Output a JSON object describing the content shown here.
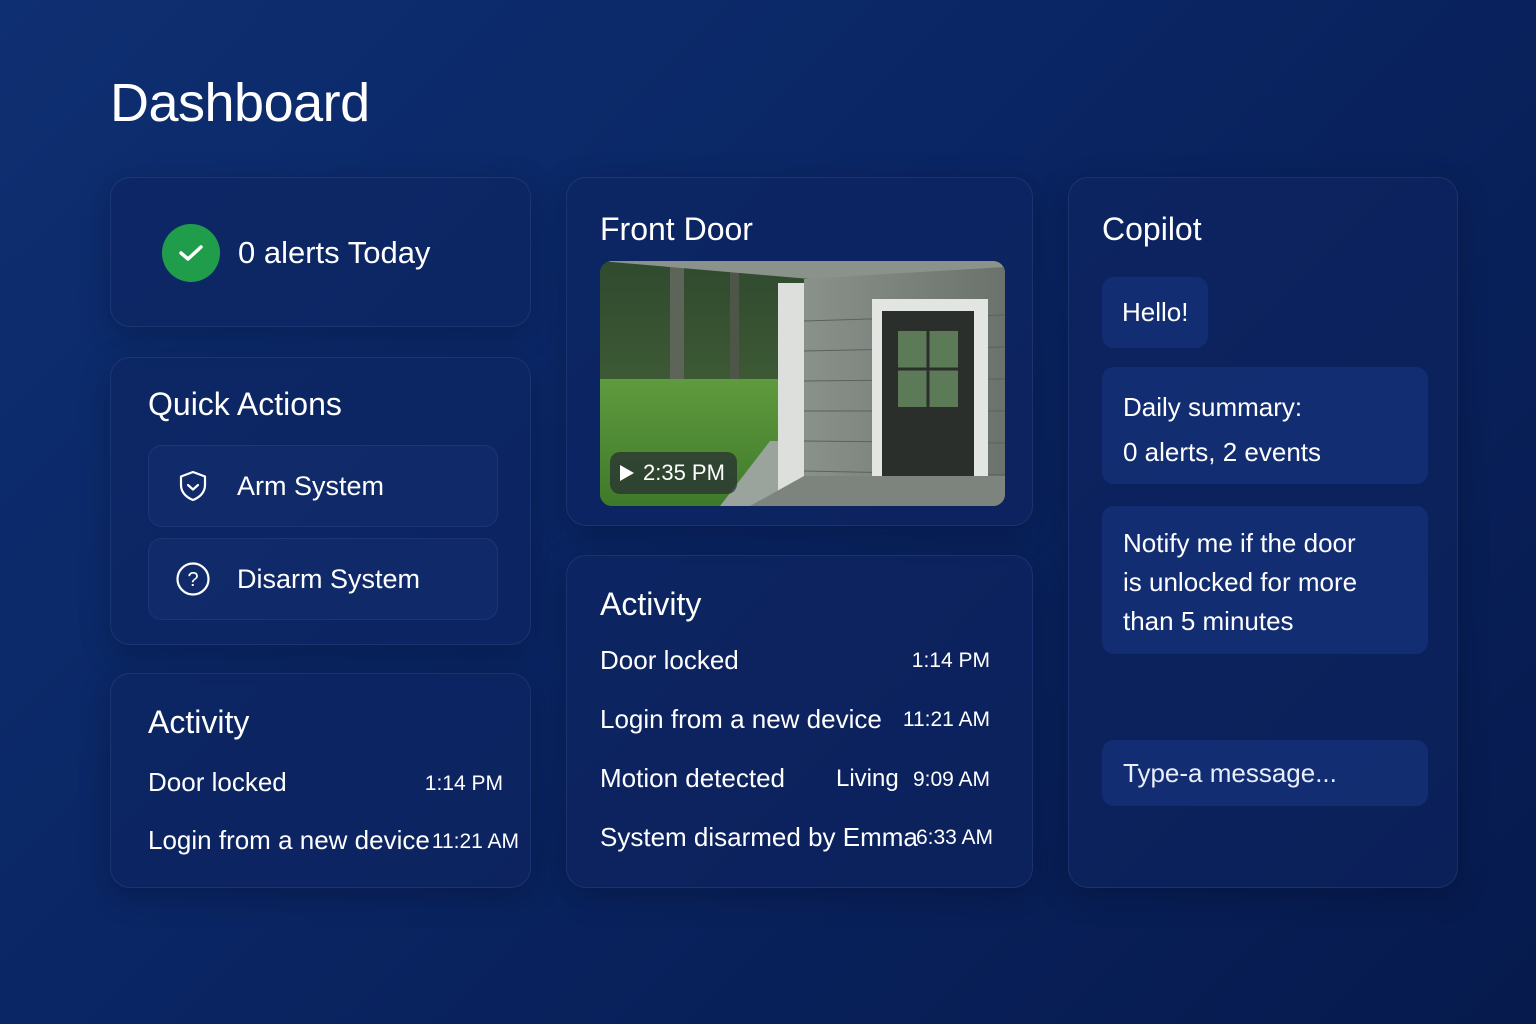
{
  "header": {
    "title": "Dashboard"
  },
  "alerts": {
    "text": "0 alerts Today",
    "status_color": "#1f9d4b",
    "icon": "check-icon"
  },
  "quick_actions": {
    "title": "Quick Actions",
    "items": [
      {
        "label": "Arm System",
        "icon": "shield-icon"
      },
      {
        "label": "Disarm System",
        "icon": "help-circle-icon"
      }
    ]
  },
  "activity_left": {
    "title": "Activity",
    "items": [
      {
        "event": "Door locked",
        "time": "1:14 PM"
      },
      {
        "event": "Login from a new device",
        "time": "11:21 AM"
      }
    ]
  },
  "front_door": {
    "title": "Front Door",
    "timestamp": "2:35 PM",
    "icon": "play-icon"
  },
  "activity_mid": {
    "title": "Activity",
    "items": [
      {
        "event": "Door locked",
        "location": "",
        "time": "1:14 PM"
      },
      {
        "event": "Login from a new device",
        "location": "",
        "time": "11:21 AM"
      },
      {
        "event": "Motion detected",
        "location": "Living",
        "time": "9:09 AM"
      },
      {
        "event": "System disarmed by Emma",
        "location": "",
        "time": "6:33 AM"
      }
    ]
  },
  "copilot": {
    "title": "Copilot",
    "messages": [
      {
        "text": "Hello!"
      },
      {
        "line1": "Daily summary:",
        "line2": "0 alerts, 2 events"
      },
      {
        "line1": "Notify me if the door",
        "line2": "is unlocked for more",
        "line3": "than 5 minutes"
      }
    ],
    "input_placeholder": "Type-a message..."
  }
}
